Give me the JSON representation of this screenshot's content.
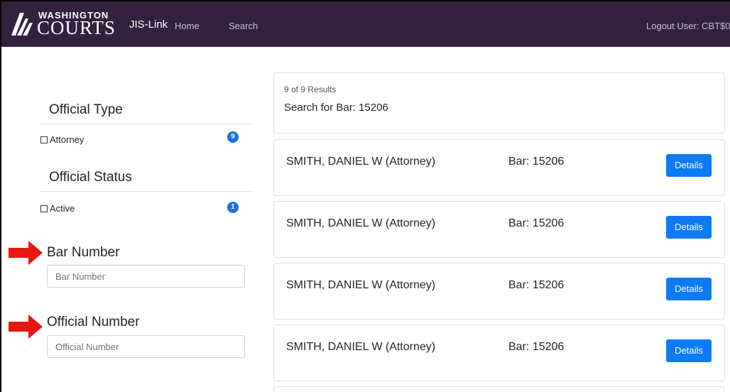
{
  "navbar": {
    "logo_top": "WASHINGTON",
    "logo_main": "COURTS",
    "brand": "JIS-Link",
    "links": [
      "Home",
      "Search"
    ],
    "right_text": "Logout  User: CBT$0"
  },
  "filters": {
    "official_type": {
      "heading": "Official Type",
      "option_label": "Attorney",
      "count": "9"
    },
    "official_status": {
      "heading": "Official Status",
      "option_label": "Active",
      "count": "1"
    },
    "bar_number": {
      "label": "Bar Number",
      "placeholder": "Bar Number",
      "value": ""
    },
    "official_number": {
      "label": "Official Number",
      "placeholder": "Official Number",
      "value": ""
    }
  },
  "results": {
    "count_text": "9 of 9 Results",
    "query_text": "Search for Bar: 15206",
    "items": [
      {
        "name": "SMITH, DANIEL W (Attorney)",
        "bar": "Bar: 15206",
        "button": "Details"
      },
      {
        "name": "SMITH, DANIEL W (Attorney)",
        "bar": "Bar: 15206",
        "button": "Details"
      },
      {
        "name": "SMITH, DANIEL W (Attorney)",
        "bar": "Bar: 15206",
        "button": "Details"
      },
      {
        "name": "SMITH, DANIEL W (Attorney)",
        "bar": "Bar: 15206",
        "button": "Details"
      }
    ]
  },
  "colors": {
    "navbar_bg": "#34203f",
    "badge": "#1a6ee6",
    "button": "#0d7bf3",
    "annotation_arrow": "#e8170f"
  },
  "icons": [
    "washington-courts-logo-icon",
    "red-arrow-icon"
  ]
}
